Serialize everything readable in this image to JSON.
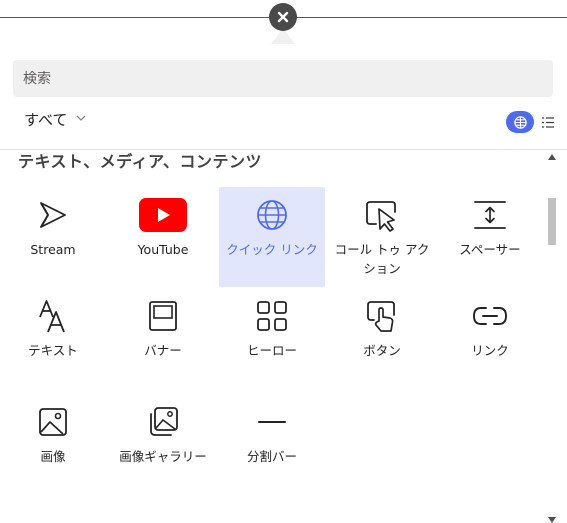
{
  "search": {
    "placeholder": "検索",
    "value": ""
  },
  "filter": {
    "label": "すべて"
  },
  "section": {
    "title": "テキスト、メディア、コンテンツ"
  },
  "colors": {
    "accent": "#4f6bed",
    "selected_bg": "#e1e6fc",
    "youtube_red": "#ff0000"
  },
  "items": [
    {
      "label": "Stream",
      "icon": "stream-icon"
    },
    {
      "label": "YouTube",
      "icon": "youtube-icon"
    },
    {
      "label": "クイック リンク",
      "icon": "globe-icon",
      "selected": true
    },
    {
      "label": "コール トゥ アクション",
      "icon": "call-to-action-icon"
    },
    {
      "label": "スペーサー",
      "icon": "spacer-icon"
    },
    {
      "label": "テキスト",
      "icon": "text-icon"
    },
    {
      "label": "バナー",
      "icon": "banner-icon"
    },
    {
      "label": "ヒーロー",
      "icon": "hero-icon"
    },
    {
      "label": "ボタン",
      "icon": "button-icon"
    },
    {
      "label": "リンク",
      "icon": "link-icon"
    },
    {
      "label": "画像",
      "icon": "image-icon"
    },
    {
      "label": "画像ギャラリー",
      "icon": "image-gallery-icon"
    },
    {
      "label": "分割バー",
      "icon": "divider-icon"
    }
  ]
}
